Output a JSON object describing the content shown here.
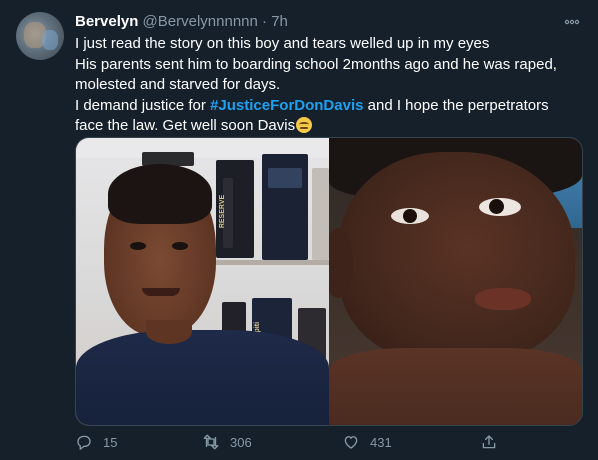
{
  "tweet": {
    "display_name": "Bervelyn",
    "handle": "@Bervelynnnnnn",
    "separator": "·",
    "time": "7h",
    "text": {
      "line1": "I just read the story on this boy and tears welled up in my eyes",
      "line2": "His parents sent him to boarding school 2months ago and he was raped, molested and starved for days.",
      "line3_before": "I demand justice for ",
      "hashtag": "#JusticeForDonDavis",
      "line3_after": " and I hope the perpetrators face the law. Get well soon Davis"
    },
    "media": {
      "left_image": "boy-smiling-photo",
      "right_image": "boy-injured-photo",
      "bottle_labels": [
        "RESERVE",
        "Sapiti"
      ]
    },
    "actions": {
      "replies": "15",
      "retweets": "306",
      "likes": "431"
    }
  },
  "colors": {
    "background": "#15202b",
    "text": "#ffffff",
    "muted": "#8899a6",
    "hashtag": "#1da1f2",
    "border": "#38444d"
  },
  "icons": [
    "more-icon",
    "reply-icon",
    "retweet-icon",
    "like-icon",
    "share-icon",
    "face-emoji-icon"
  ]
}
